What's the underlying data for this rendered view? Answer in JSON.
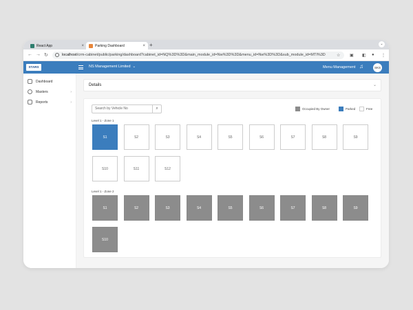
{
  "browser": {
    "tabs": [
      {
        "label": "React App",
        "favicon_color": "#2d7d6e"
      },
      {
        "label": "Parking Dashboard",
        "favicon_color": "#e8863a"
      }
    ],
    "url_host": "localhost",
    "url_path": "/crm-cabinet/public/parking/dashboard?cabinet_id=NQ%3D%3D&main_module_id=Nw%3D%3D&menu_id=Nw%3D%3D&sub_module_id=MTI%3D"
  },
  "appbar": {
    "logo": "STARS",
    "org": "NS Management Limited",
    "menu_management": "Menu Management",
    "avatar": "SKS"
  },
  "sidebar": {
    "items": [
      {
        "label": "Dashboard"
      },
      {
        "label": "Masters"
      },
      {
        "label": "Reports"
      }
    ]
  },
  "details": {
    "title": "Details"
  },
  "search": {
    "placeholder": "Search by Vehicle No"
  },
  "legend": {
    "occupied": "Occupied By Owner",
    "parked": "Parked",
    "free": "Free",
    "colors": {
      "occupied": "#8c8c8c",
      "parked": "#3b7dbd",
      "free": "#ffffff"
    }
  },
  "zones": [
    {
      "label": "Level 1 - Zone 1",
      "slots": [
        {
          "id": "S1",
          "status": "parked"
        },
        {
          "id": "S2",
          "status": "free"
        },
        {
          "id": "S3",
          "status": "free"
        },
        {
          "id": "S4",
          "status": "free"
        },
        {
          "id": "S5",
          "status": "free"
        },
        {
          "id": "S6",
          "status": "free"
        },
        {
          "id": "S7",
          "status": "free"
        },
        {
          "id": "S8",
          "status": "free"
        },
        {
          "id": "S9",
          "status": "free"
        },
        {
          "id": "S10",
          "status": "free"
        },
        {
          "id": "S11",
          "status": "free"
        },
        {
          "id": "S12",
          "status": "free"
        }
      ]
    },
    {
      "label": "Level 1 - Zone 2",
      "slots": [
        {
          "id": "S1",
          "status": "occupied"
        },
        {
          "id": "S2",
          "status": "occupied"
        },
        {
          "id": "S3",
          "status": "occupied"
        },
        {
          "id": "S4",
          "status": "occupied"
        },
        {
          "id": "S5",
          "status": "occupied"
        },
        {
          "id": "S6",
          "status": "occupied"
        },
        {
          "id": "S7",
          "status": "occupied"
        },
        {
          "id": "S8",
          "status": "occupied"
        },
        {
          "id": "S9",
          "status": "occupied"
        },
        {
          "id": "S10",
          "status": "occupied"
        }
      ]
    }
  ]
}
